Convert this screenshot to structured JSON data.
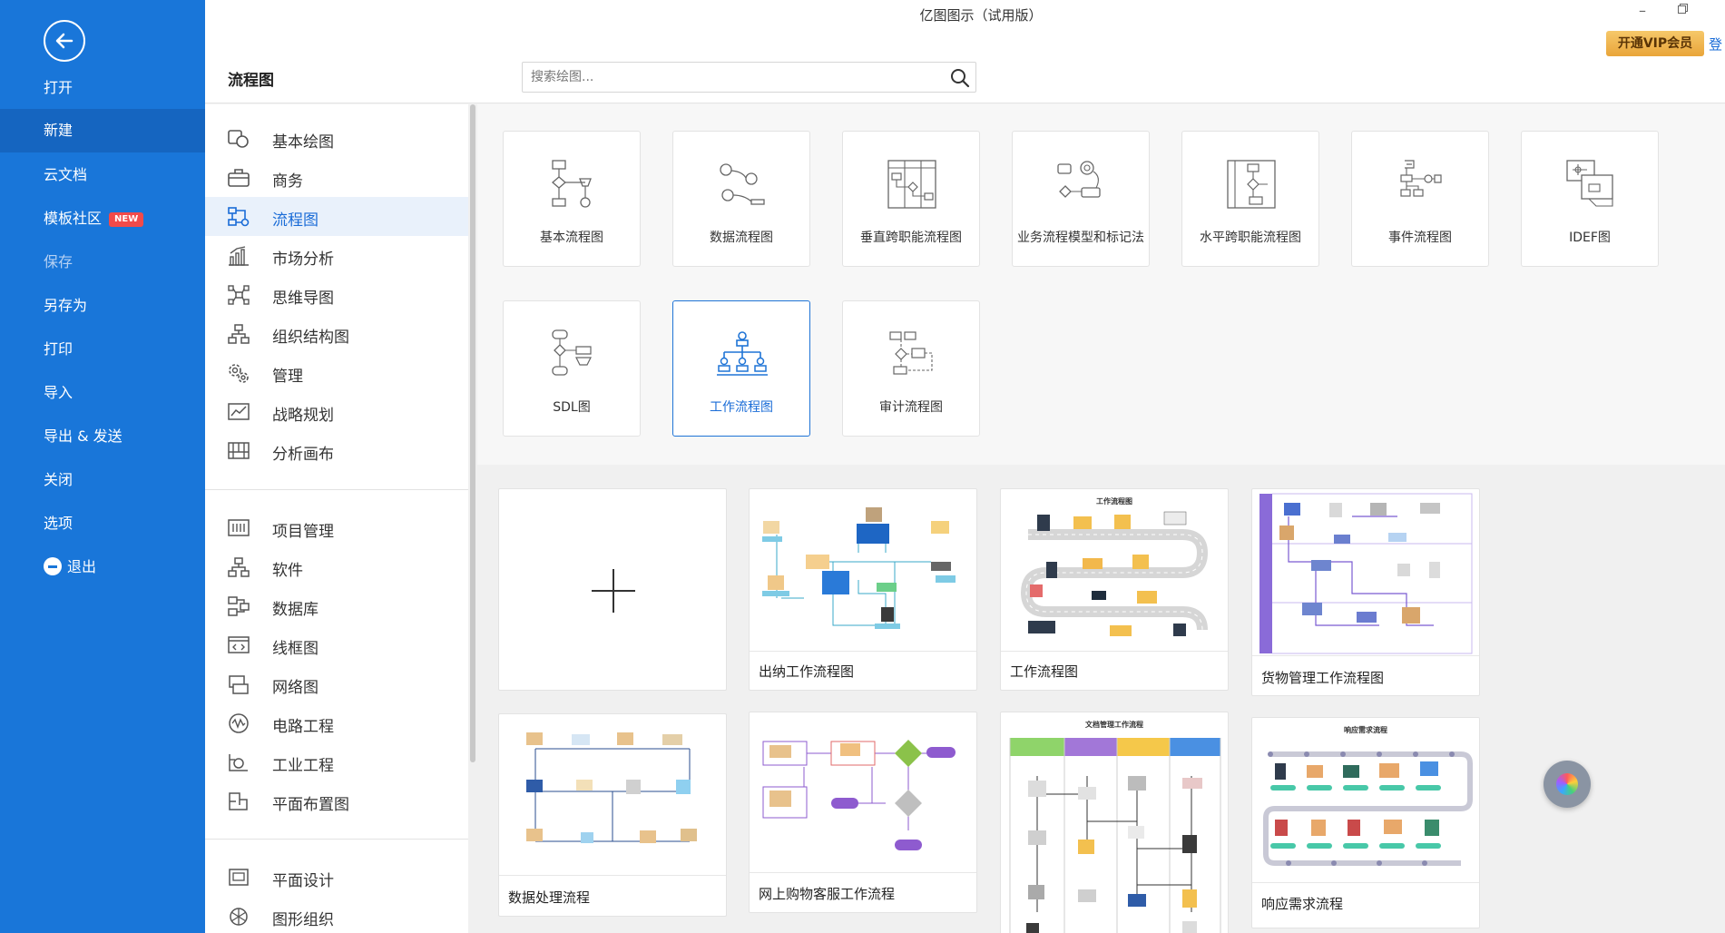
{
  "app": {
    "title": "亿图图示（试用版）",
    "vip_label": "开通VIP会员",
    "login_label": "登"
  },
  "nav": {
    "items": [
      {
        "label": "打开"
      },
      {
        "label": "新建"
      },
      {
        "label": "云文档"
      },
      {
        "label": "模板社区",
        "badge": "NEW"
      },
      {
        "label": "保存"
      },
      {
        "label": "另存为"
      },
      {
        "label": "打印"
      },
      {
        "label": "导入"
      },
      {
        "label": "导出 & 发送"
      },
      {
        "label": "关闭"
      },
      {
        "label": "选项"
      },
      {
        "label": "退出"
      }
    ],
    "active": "新建"
  },
  "section": {
    "title": "流程图"
  },
  "search": {
    "placeholder": "搜索绘图..."
  },
  "categories": [
    {
      "label": "基本绘图",
      "icon": "basic-shapes-icon"
    },
    {
      "label": "商务",
      "icon": "briefcase-icon"
    },
    {
      "label": "流程图",
      "icon": "flowchart-icon"
    },
    {
      "label": "市场分析",
      "icon": "bar-chart-icon"
    },
    {
      "label": "思维导图",
      "icon": "mindmap-icon"
    },
    {
      "label": "组织结构图",
      "icon": "org-chart-icon"
    },
    {
      "label": "管理",
      "icon": "management-icon"
    },
    {
      "label": "战略规划",
      "icon": "strategy-icon"
    },
    {
      "label": "分析画布",
      "icon": "canvas-icon"
    },
    {
      "label": "项目管理",
      "icon": "project-icon"
    },
    {
      "label": "软件",
      "icon": "software-icon"
    },
    {
      "label": "数据库",
      "icon": "database-icon"
    },
    {
      "label": "线框图",
      "icon": "wireframe-icon"
    },
    {
      "label": "网络图",
      "icon": "network-icon"
    },
    {
      "label": "电路工程",
      "icon": "circuit-icon"
    },
    {
      "label": "工业工程",
      "icon": "industrial-icon"
    },
    {
      "label": "平面布置图",
      "icon": "floorplan-icon"
    },
    {
      "label": "平面设计",
      "icon": "graphic-design-icon"
    },
    {
      "label": "图形组织",
      "icon": "graphic-organizer-icon"
    }
  ],
  "active_category": "流程图",
  "subtypes": [
    {
      "label": "基本流程图"
    },
    {
      "label": "数据流程图"
    },
    {
      "label": "垂直跨职能流程图"
    },
    {
      "label": "业务流程模型和标记法"
    },
    {
      "label": "水平跨职能流程图"
    },
    {
      "label": "事件流程图"
    },
    {
      "label": "IDEF图"
    },
    {
      "label": "SDL图"
    },
    {
      "label": "工作流程图"
    },
    {
      "label": "审计流程图"
    }
  ],
  "active_subtype": "工作流程图",
  "templates": [
    {
      "label": "出纳工作流程图"
    },
    {
      "label": "工作流程图",
      "thumb_title": "工作流程图"
    },
    {
      "label": "货物管理工作流程图"
    },
    {
      "label": "数据处理流程"
    },
    {
      "label": "网上购物客服工作流程"
    },
    {
      "label": "响应需求流程",
      "thumb_title": "响应需求流程"
    },
    {
      "label": "",
      "thumb_title": "文档管理工作流程"
    }
  ],
  "colors": {
    "nav_bg": "#1976d9",
    "accent": "#1a6cd7",
    "vip": "#e9a53a",
    "new_badge": "#f24a4a"
  }
}
